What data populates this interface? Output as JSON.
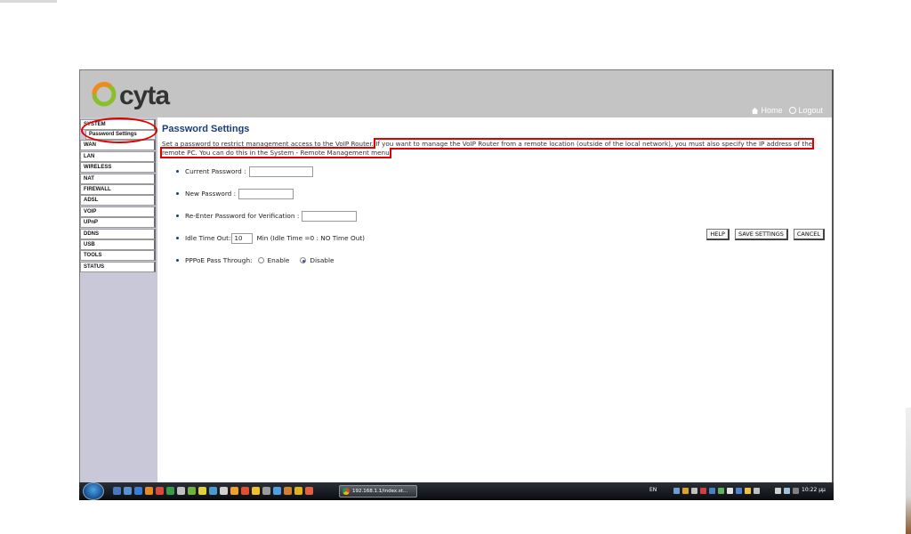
{
  "colors": {
    "header_bg": "#c4c4c4",
    "sidebar_bg": "#c8c8d8",
    "title_color": "#1a3e7a",
    "annotation_red": "#e00000",
    "taskbar_bg": "#0a0c10"
  },
  "brand": {
    "logo_text": "cyta",
    "logo_icon": "cyta-swirl-logo"
  },
  "header": {
    "home_label": "Home",
    "logout_label": "Logout"
  },
  "sidebar": {
    "items": [
      {
        "label": "SYSTEM"
      },
      {
        "label": "WAN"
      },
      {
        "label": "LAN"
      },
      {
        "label": "WIRELESS"
      },
      {
        "label": "NAT"
      },
      {
        "label": "FIREWALL"
      },
      {
        "label": "ADSL"
      },
      {
        "label": "VOIP"
      },
      {
        "label": "UPnP"
      },
      {
        "label": "DDNS"
      },
      {
        "label": "USB"
      },
      {
        "label": "TOOLS"
      },
      {
        "label": "STATUS"
      }
    ],
    "sub_item": "Password Settings"
  },
  "main": {
    "title": "Password Settings",
    "desc_part1": "Set a password to restrict management access to the VoIP Router. ",
    "desc_part2": "If you want to manage the VoIP Router from a remote location (outside of the local network), you must also specify the IP address of the remote PC. You can do this in the System - Remote Management menu",
    "form": {
      "current_password_label": "Current Password :",
      "new_password_label": "New Password :",
      "reenter_label": "Re-Enter Password for Verification :",
      "idle_label": "Idle Time Out:",
      "idle_value": "10",
      "idle_suffix": "Min (Idle Time =0 : NO Time Out)",
      "pppoe_label": "PPPoE Pass Through:",
      "enable_label": "Enable",
      "disable_label": "Disable",
      "pppoe_selected": "Disable"
    },
    "buttons": {
      "help": "HELP",
      "save": "SAVE SETTINGS",
      "cancel": "CANCEL"
    }
  },
  "taskbar": {
    "task_label": "192.168.1.1/index.st...",
    "language": "EN",
    "clock": "10:22 μμ"
  }
}
